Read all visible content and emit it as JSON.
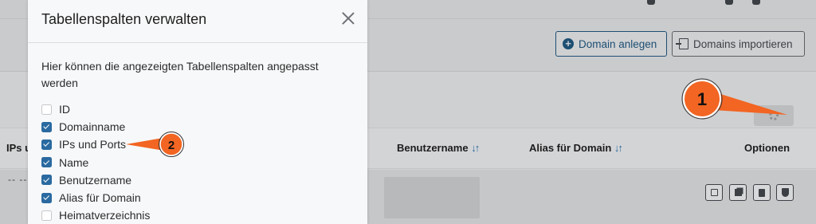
{
  "header": {
    "create_domain_label": "Domain anlegen",
    "import_domains_label": "Domains importieren"
  },
  "table": {
    "headers": {
      "ips": "IPs u",
      "username": "Benutzername",
      "alias": "Alias für Domain",
      "options": "Optionen"
    },
    "sort_icon": "↓↑",
    "row_placeholder": "-- --"
  },
  "modal": {
    "title": "Tabellenspalten verwalten",
    "description": "Hier können die angezeigten Tabellenspalten angepasst werden",
    "columns": [
      {
        "label": "ID",
        "checked": false
      },
      {
        "label": "Domainname",
        "checked": true
      },
      {
        "label": "IPs und Ports",
        "checked": true
      },
      {
        "label": "Name",
        "checked": true
      },
      {
        "label": "Benutzername",
        "checked": true
      },
      {
        "label": "Alias für Domain",
        "checked": true
      },
      {
        "label": "Heimatverzeichnis",
        "checked": false
      }
    ]
  },
  "annotations": [
    {
      "number": "1",
      "target": "gear-button"
    },
    {
      "number": "2",
      "target": "IPs und Ports"
    }
  ],
  "colors": {
    "accent": "#2a6aa0",
    "annotation": "#f26522"
  },
  "icons": [
    "circle-plus-icon",
    "file-import-icon",
    "gear-icon",
    "close-icon",
    "edit-icon",
    "copy-icon",
    "file-icon",
    "shield-icon"
  ]
}
